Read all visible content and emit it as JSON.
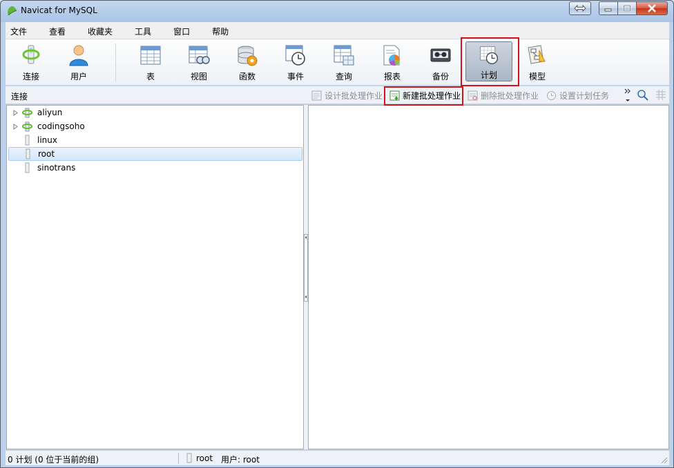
{
  "window": {
    "title": "Navicat for MySQL"
  },
  "menu": [
    "文件",
    "查看",
    "收藏夹",
    "工具",
    "窗口",
    "帮助"
  ],
  "toolbar": {
    "items": [
      {
        "label": "连接",
        "icon": "connection-icon"
      },
      {
        "label": "用户",
        "icon": "user-icon"
      },
      {
        "label": "表",
        "icon": "table-icon"
      },
      {
        "label": "视图",
        "icon": "view-icon"
      },
      {
        "label": "函数",
        "icon": "function-icon"
      },
      {
        "label": "事件",
        "icon": "event-icon"
      },
      {
        "label": "查询",
        "icon": "query-icon"
      },
      {
        "label": "报表",
        "icon": "report-icon"
      },
      {
        "label": "备份",
        "icon": "backup-icon"
      },
      {
        "label": "计划",
        "icon": "schedule-icon",
        "active": true
      },
      {
        "label": "模型",
        "icon": "model-icon"
      }
    ]
  },
  "subbar": {
    "title": "连接",
    "buttons": {
      "design": "设计批处理作业",
      "new": "新建批处理作业",
      "delete": "删除批处理作业",
      "set_task": "设置计划任务"
    }
  },
  "tree": {
    "items": [
      {
        "label": "aliyun",
        "expandable": true,
        "connected": true
      },
      {
        "label": "codingsoho",
        "expandable": true,
        "connected": true
      },
      {
        "label": "linux",
        "expandable": false,
        "connected": false
      },
      {
        "label": "root",
        "expandable": false,
        "connected": false,
        "selected": true
      },
      {
        "label": "sinotrans",
        "expandable": false,
        "connected": false
      }
    ]
  },
  "status": {
    "left": "0 计划 (0 位于当前的组)",
    "connection": "root",
    "user": "用户: root"
  },
  "colors": {
    "highlight_box": "#d4121c",
    "selection": "#d5e7fb"
  }
}
